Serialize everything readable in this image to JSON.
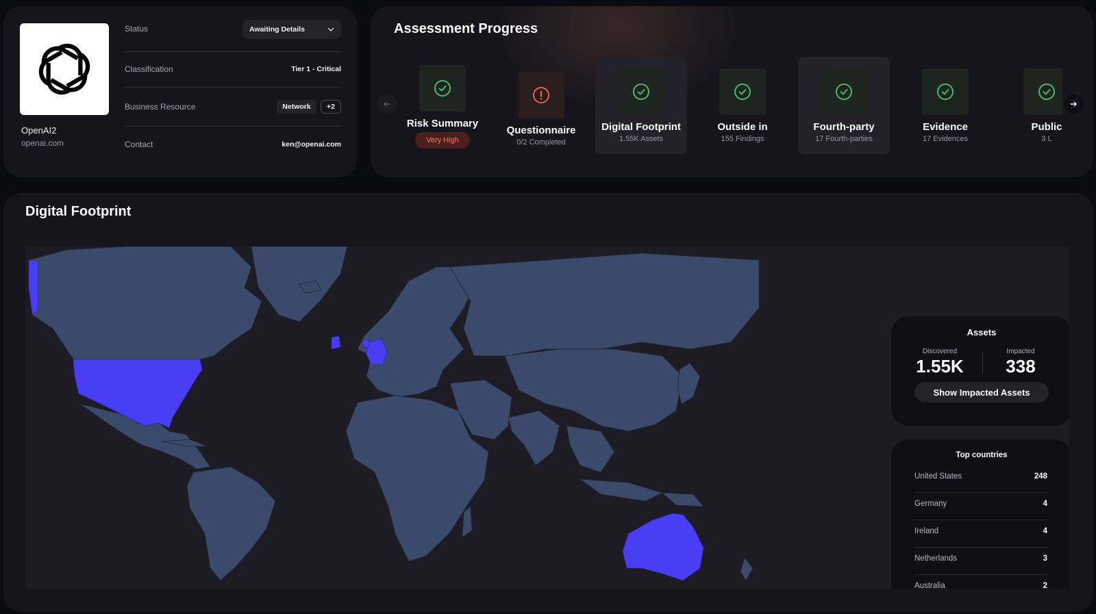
{
  "vendor": {
    "name": "OpenAI2",
    "domain": "openai.com",
    "status_label": "Status",
    "status_value": "Awaiting Details",
    "classification_label": "Classification",
    "classification_value": "Tier 1 - Critical",
    "business_resource_label": "Business Resource",
    "business_resource_chip": "Network",
    "business_resource_more": "+2",
    "contact_label": "Contact",
    "contact_value": "ken@openai.com"
  },
  "assessment": {
    "title": "Assessment Progress",
    "steps": [
      {
        "title": "Risk Summary",
        "badge": "Very High",
        "icon": "check-circle-icon",
        "state": "done"
      },
      {
        "title": "Questionnaire",
        "sub": "0/2 Completed",
        "icon": "alert-circle-icon",
        "state": "warning"
      },
      {
        "title": "Digital Footprint",
        "sub": "1.55K Assets",
        "icon": "check-circle-icon",
        "state": "done"
      },
      {
        "title": "Outside in",
        "sub": "155 Findings",
        "icon": "check-circle-icon",
        "state": "done"
      },
      {
        "title": "Fourth-party",
        "sub": "17 Fourth-parties",
        "icon": "check-circle-icon",
        "state": "done"
      },
      {
        "title": "Evidence",
        "sub": "17 Evidences",
        "icon": "check-circle-icon",
        "state": "done"
      },
      {
        "title": "Public",
        "sub": "3 L",
        "icon": "check-circle-icon",
        "state": "done"
      }
    ]
  },
  "footprint": {
    "title": "Digital Footprint",
    "assets": {
      "title": "Assets",
      "discovered_label": "Discovered",
      "discovered_value": "1.55K",
      "impacted_label": "Impacted",
      "impacted_value": "338",
      "button_label": "Show Impacted Assets"
    },
    "top_countries": {
      "title": "Top countries",
      "rows": [
        {
          "name": "United States",
          "count": "248"
        },
        {
          "name": "Germany",
          "count": "4"
        },
        {
          "name": "Ireland",
          "count": "4"
        },
        {
          "name": "Netherlands",
          "count": "3"
        },
        {
          "name": "Australia",
          "count": "2"
        }
      ]
    },
    "highlighted_countries": [
      "United States",
      "Germany",
      "Ireland",
      "Netherlands",
      "Australia"
    ]
  },
  "colors": {
    "highlight": "#4a3ef5",
    "land": "#3b4a6b",
    "success": "#4fb868",
    "warning": "#e8614a",
    "card": "#16151d",
    "background": "#0a0a12"
  }
}
